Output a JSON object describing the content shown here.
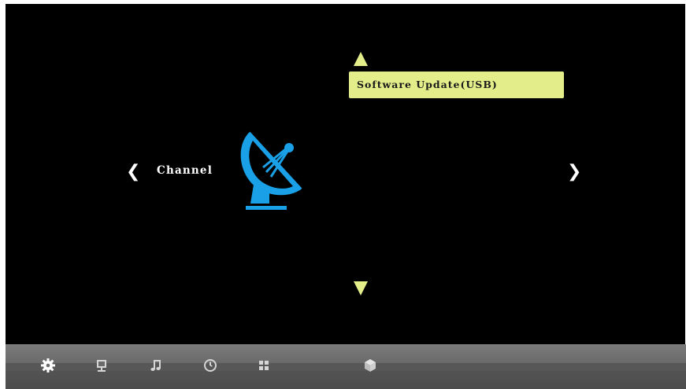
{
  "menu": {
    "category_label": "Channel",
    "selected_item_label": "Software Update(USB)",
    "left_arrow_glyph": "❮",
    "right_arrow_glyph": "❯",
    "category_icon": "satellite-dish-icon"
  },
  "dock": {
    "items": [
      {
        "name": "settings",
        "icon": "gear-icon",
        "active": true
      },
      {
        "name": "picture",
        "icon": "monitor-icon",
        "active": false
      },
      {
        "name": "sound",
        "icon": "music-note-icon",
        "active": false
      },
      {
        "name": "time",
        "icon": "clock-icon",
        "active": false
      },
      {
        "name": "apps",
        "icon": "grid-icon",
        "active": false
      },
      {
        "name": "3d",
        "icon": "cube-icon",
        "active": false
      }
    ]
  },
  "colors": {
    "background": "#000000",
    "highlight": "#e3ee8a",
    "icon_accent": "#1aa0e6",
    "dock": "#6a6a6a"
  }
}
